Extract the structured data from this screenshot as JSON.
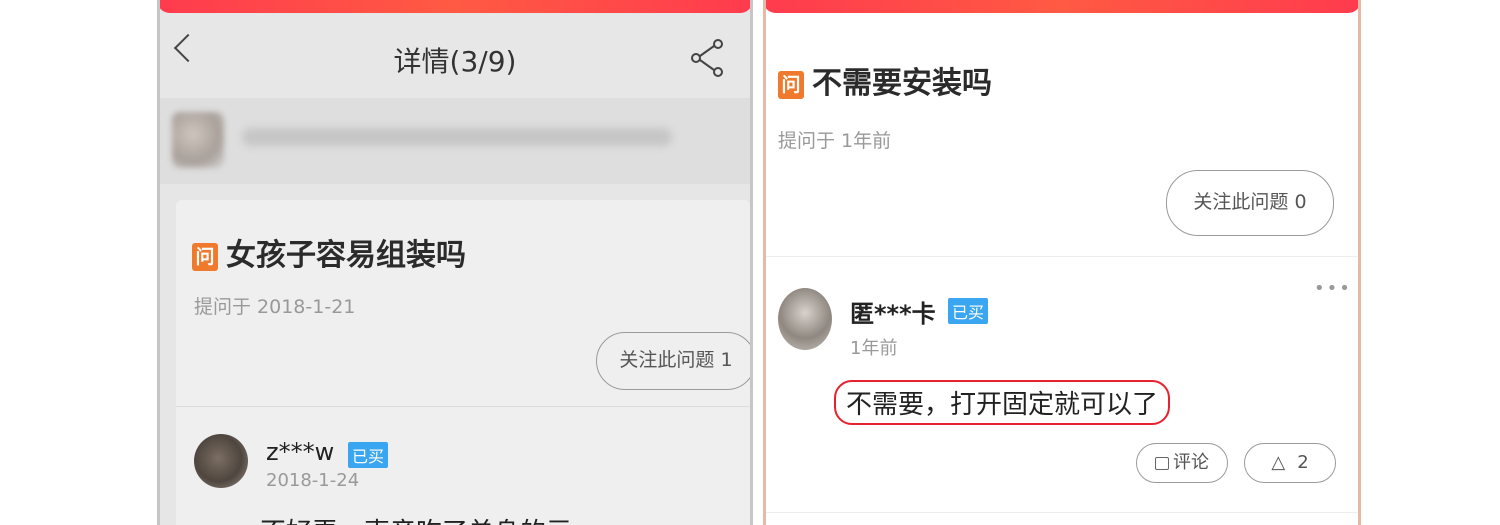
{
  "left": {
    "nav_title": "详情(3/9)",
    "question": {
      "icon_text": "问",
      "title": "女孩子容易组装吗",
      "time": "提问于 2018-1-21",
      "follow_label": "关注此问题 1"
    },
    "answer": {
      "user": "z***w",
      "badge": "已买",
      "date": "2018-1-24",
      "text": "不好弄，声音吃了单身的亏"
    },
    "icons": [
      "back-arrow-icon",
      "share-icon"
    ]
  },
  "right": {
    "question": {
      "icon_text": "问",
      "title": "不需要安装吗",
      "time": "提问于 1年前",
      "follow_label": "关注此问题 0"
    },
    "answer": {
      "user": "匿***卡",
      "badge": "已买",
      "date": "1年前",
      "text": "不需要，打开固定就可以了",
      "highlight_color": "#e8212e"
    },
    "actions": {
      "comment_label": "评论",
      "like_count": "2"
    },
    "icons": [
      "more-dots-icon",
      "comment-icon",
      "like-icon"
    ]
  },
  "colors": {
    "accent": "#ff3b4e",
    "question_icon": "#ef7a2e",
    "bought_badge": "#3aa5f0"
  }
}
